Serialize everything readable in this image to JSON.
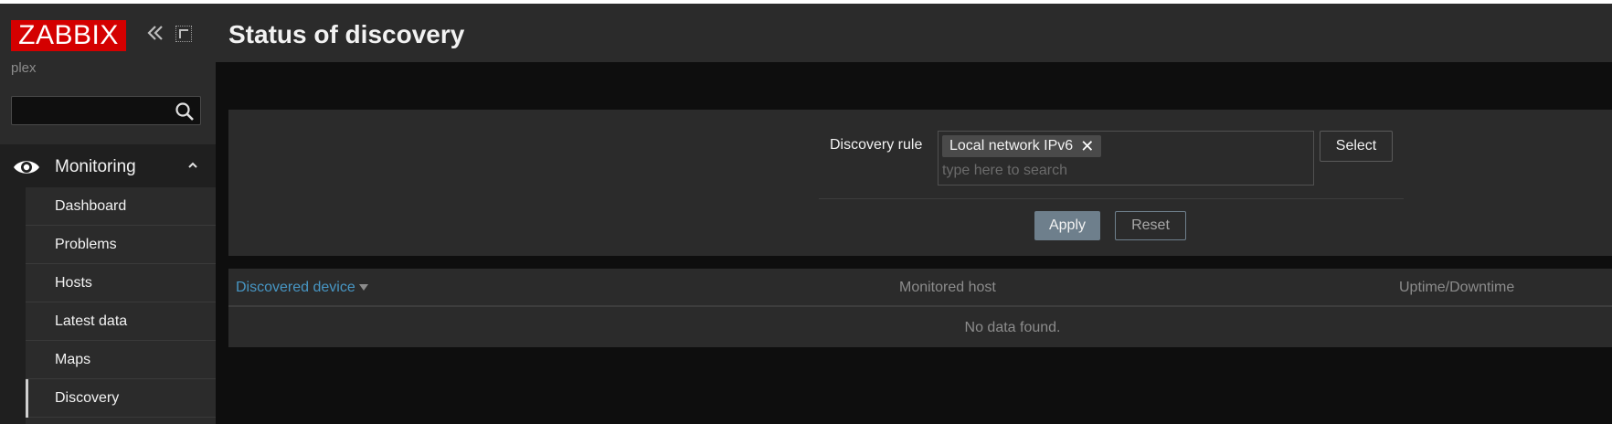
{
  "sidebar": {
    "logo": "ZABBIX",
    "server_name": "plex",
    "search": {
      "value": "",
      "placeholder": ""
    },
    "section": {
      "label": "Monitoring"
    },
    "items": [
      {
        "label": "Dashboard"
      },
      {
        "label": "Problems"
      },
      {
        "label": "Hosts"
      },
      {
        "label": "Latest data"
      },
      {
        "label": "Maps"
      },
      {
        "label": "Discovery"
      }
    ],
    "active_item": "Discovery"
  },
  "header": {
    "title": "Status of discovery"
  },
  "filter": {
    "label": "Discovery rule",
    "selected_chip": "Local network IPv6",
    "chip_remove": "✕",
    "input_placeholder": "type here to search",
    "select_label": "Select",
    "apply_label": "Apply",
    "reset_label": "Reset"
  },
  "table": {
    "columns": [
      "Discovered device",
      "Monitored host",
      "Uptime/Downtime"
    ],
    "empty_message": "No data found."
  },
  "colors": {
    "brand": "#d40000",
    "background": "#0e0e0e",
    "panel": "#2b2b2b",
    "link": "#4796c4",
    "apply": "#6e7f8c"
  }
}
